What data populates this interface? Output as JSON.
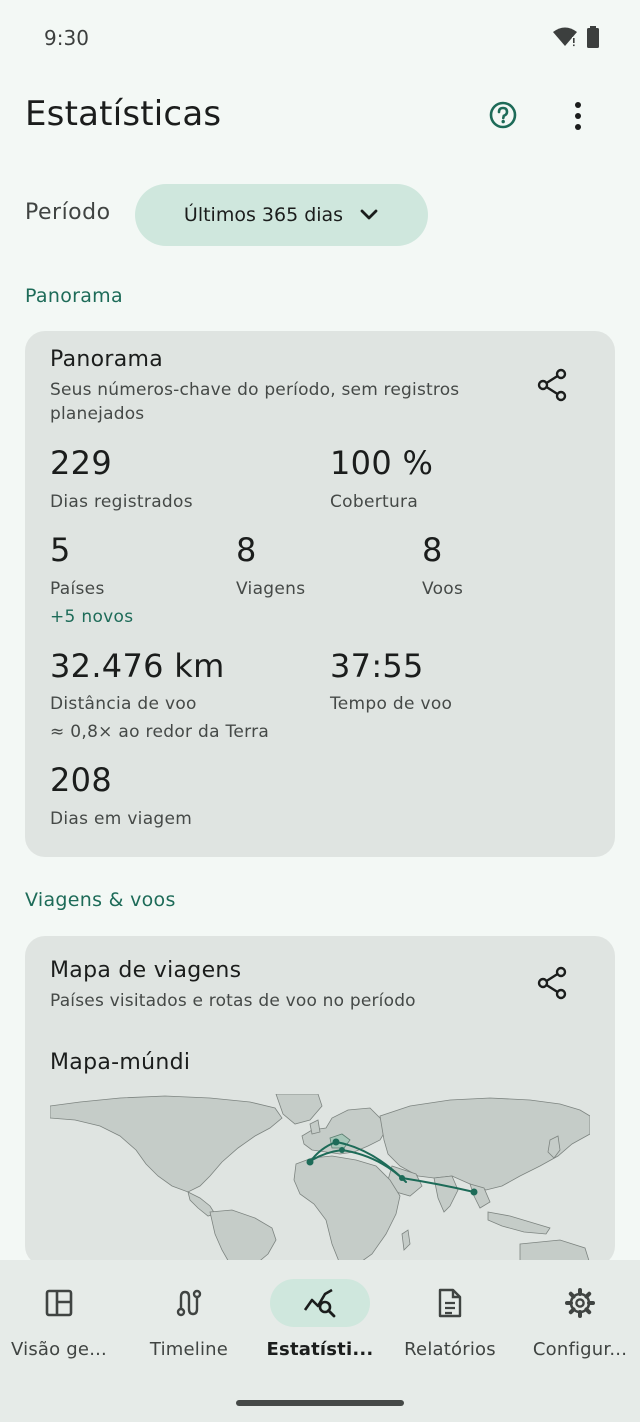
{
  "status": {
    "time": "9:30"
  },
  "header": {
    "title": "Estatísticas"
  },
  "period": {
    "label": "Período",
    "selected": "Últimos 365 dias"
  },
  "sections": {
    "overview": "Panorama",
    "travel": "Viagens & voos"
  },
  "overview_card": {
    "title": "Panorama",
    "subtitle": "Seus números-chave do período, sem registros planejados",
    "stats": {
      "days_recorded": {
        "value": "229",
        "label": "Dias registrados"
      },
      "coverage": {
        "value": "100 %",
        "label": "Cobertura"
      },
      "countries": {
        "value": "5",
        "label": "Países",
        "note": "+5 novos"
      },
      "trips": {
        "value": "8",
        "label": "Viagens"
      },
      "flights": {
        "value": "8",
        "label": "Voos"
      },
      "flight_distance": {
        "value": "32.476 km",
        "label": "Distância de voo",
        "note": "≈ 0,8× ao redor da Terra"
      },
      "flight_time": {
        "value": "37:55",
        "label": "Tempo de voo"
      },
      "travel_days": {
        "value": "208",
        "label": "Dias em viagem"
      }
    }
  },
  "map_card": {
    "title": "Mapa de viagens",
    "subtitle": "Países visitados e rotas de voo no período",
    "map_title": "Mapa-múndi"
  },
  "nav": {
    "items": [
      {
        "label": "Visão ge...",
        "icon": "dashboard-icon"
      },
      {
        "label": "Timeline",
        "icon": "route-icon"
      },
      {
        "label": "Estatísti...",
        "icon": "stats-icon"
      },
      {
        "label": "Relatórios",
        "icon": "report-icon"
      },
      {
        "label": "Configur...",
        "icon": "gear-icon"
      }
    ],
    "active_index": 2
  },
  "colors": {
    "accent": "#1d6b58",
    "chip": "#cfe7dd",
    "card": "#dfe4e1",
    "background": "#f3f8f5"
  }
}
